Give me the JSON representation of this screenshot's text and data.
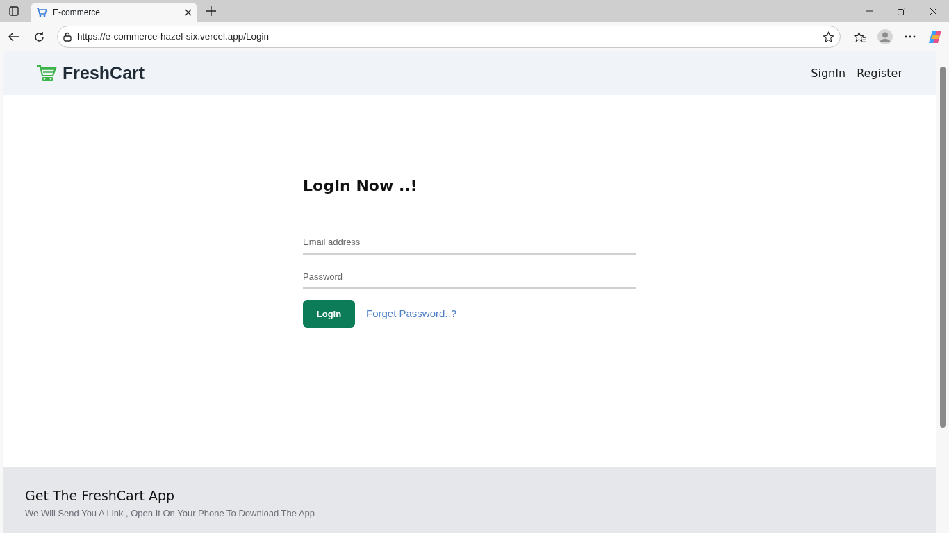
{
  "browser": {
    "tab_title": "E-commerce",
    "url": "https://e-commerce-hazel-six.vercel.app/Login"
  },
  "navbar": {
    "brand": "FreshCart",
    "links": [
      "SignIn",
      "Register"
    ]
  },
  "login": {
    "heading": "LogIn Now ..!",
    "fields": [
      {
        "placeholder": "Email address"
      },
      {
        "placeholder": "Password"
      }
    ],
    "button": "Login",
    "link": "Forget Password..?"
  },
  "footer": {
    "title": "Get The FreshCart App",
    "text": "We Will Send You A Link , Open It On Your Phone To Download The App"
  }
}
